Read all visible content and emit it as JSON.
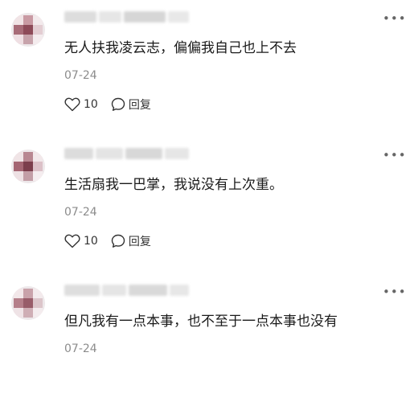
{
  "comments": [
    {
      "content": "无人扶我凌云志，偏偏我自己也上不去",
      "date": "07-24",
      "likes": "10",
      "reply_label": "回复",
      "avatar_colors": [
        "#f1e4e6",
        "#c99aa3",
        "#f3eaec",
        "#a86c78",
        "#8d4a58",
        "#e3cdd2",
        "#efdfe3",
        "#c7a3ab",
        "#f4ecee"
      ]
    },
    {
      "content": "生活扇我一巴掌，我说没有上次重。",
      "date": "07-24",
      "likes": "10",
      "reply_label": "回复",
      "avatar_colors": [
        "#f0e4e6",
        "#b88791",
        "#f2e8ea",
        "#a56673",
        "#7c3e4c",
        "#dcc1c8",
        "#eee1e4",
        "#c39ea6",
        "#f5edef"
      ]
    },
    {
      "content": "但凡我有一点本事，也不至于一点本事也没有",
      "date": "07-24",
      "avatar_colors": [
        "#f2e7e9",
        "#c9a2aa",
        "#f3eaec",
        "#b57f8a",
        "#985c69",
        "#dcc5ca",
        "#efe3e6",
        "#cfaeb5",
        "#f4ecee"
      ]
    }
  ],
  "icons": {
    "like": "heart-icon",
    "reply": "speech-bubble-icon",
    "more": "more-options-icon"
  },
  "colors": {
    "text": "#1a1a1a",
    "meta": "#8c8c8c",
    "action": "#333333"
  }
}
